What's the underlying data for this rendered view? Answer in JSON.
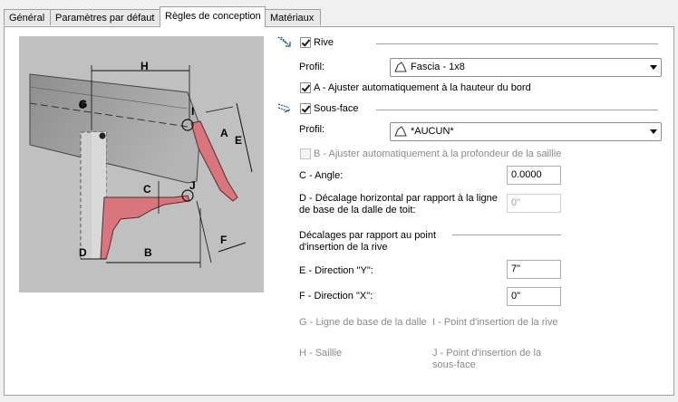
{
  "tabs": [
    {
      "label": "Général"
    },
    {
      "label": "Paramètres par défaut"
    },
    {
      "label": "Règles de conception"
    },
    {
      "label": "Matériaux"
    }
  ],
  "diagram": {
    "labels": {
      "H": "H",
      "G": "G",
      "I": "I",
      "A": "A",
      "E": "E",
      "C": "C",
      "J": "J",
      "F": "F",
      "D": "D",
      "B": "B"
    }
  },
  "rive": {
    "checkbox_label": "Rive",
    "checked": true,
    "profil_label": "Profil:",
    "profil_value": "Fascia - 1x8",
    "auto_label": "A - Ajuster automatiquement à la hauteur du bord",
    "auto_checked": true
  },
  "sous_face": {
    "checkbox_label": "Sous-face",
    "checked": true,
    "profil_label": "Profil:",
    "profil_value": "*AUCUN*",
    "auto_label": "B - Ajuster automatiquement à la profondeur de la saillie",
    "auto_checked": false,
    "angle_label": "C - Angle:",
    "angle_value": "0.0000",
    "decalage_label_1": "D - Décalage horizontal par rapport à la ligne",
    "decalage_label_2": "de base de la dalle de toit:",
    "decalage_value": "0\""
  },
  "decalages": {
    "heading_1": "Décalages par rapport au point",
    "heading_2": "d'insertion de la rive",
    "dir_y_label": "E - Direction \"Y\":",
    "dir_y_value": "7\"",
    "dir_x_label": "F - Direction \"X\":",
    "dir_x_value": "0\""
  },
  "legend": {
    "g": "G - Ligne de base de la dalle",
    "i": "I - Point d'insertion de la rive",
    "h": "H - Saillie",
    "j_1": "J - Point d'insertion de la",
    "j_2": "sous-face"
  },
  "colors": {
    "profile_red": "#d8767e",
    "roof_gray": "#9c9c9c",
    "diagram_bg": "#c0c0c0"
  }
}
